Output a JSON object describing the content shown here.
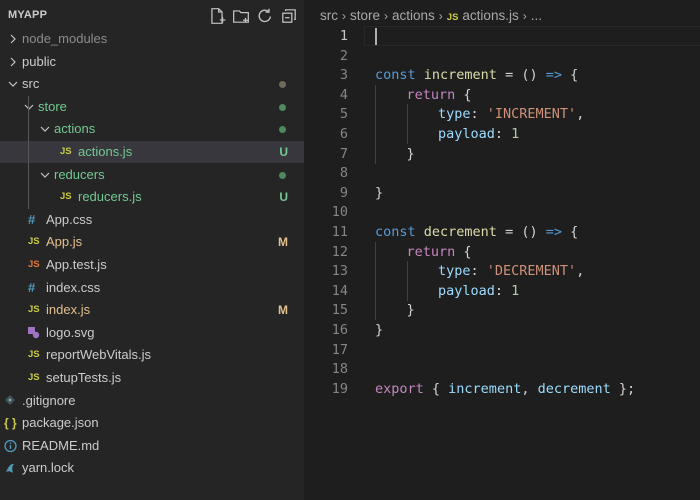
{
  "explorer": {
    "title": "MYAPP",
    "actions": [
      {
        "name": "new-file-icon"
      },
      {
        "name": "new-folder-icon"
      },
      {
        "name": "refresh-icon"
      },
      {
        "name": "collapse-all-icon"
      }
    ]
  },
  "tree": [
    {
      "label": "node_modules",
      "kind": "folder",
      "expanded": false,
      "depth": 0,
      "color": "grey"
    },
    {
      "label": "public",
      "kind": "folder",
      "expanded": false,
      "depth": 0,
      "color": "default"
    },
    {
      "label": "src",
      "kind": "folder",
      "expanded": true,
      "depth": 0,
      "color": "default",
      "decoration": "dot-grey"
    },
    {
      "label": "store",
      "kind": "folder",
      "expanded": true,
      "depth": 1,
      "color": "green",
      "decoration": "dot-green"
    },
    {
      "label": "actions",
      "kind": "folder",
      "expanded": true,
      "depth": 2,
      "color": "green",
      "decoration": "dot-green"
    },
    {
      "label": "actions.js",
      "kind": "js",
      "depth": 3,
      "color": "green",
      "badge": "U",
      "selected": true
    },
    {
      "label": "reducers",
      "kind": "folder",
      "expanded": true,
      "depth": 2,
      "color": "green",
      "decoration": "dot-green"
    },
    {
      "label": "reducers.js",
      "kind": "js",
      "depth": 3,
      "color": "green",
      "badge": "U"
    },
    {
      "label": "App.css",
      "kind": "css",
      "depth": 1,
      "color": "default"
    },
    {
      "label": "App.js",
      "kind": "js",
      "depth": 1,
      "color": "yellow",
      "badge": "M"
    },
    {
      "label": "App.test.js",
      "kind": "test",
      "depth": 1,
      "color": "default"
    },
    {
      "label": "index.css",
      "kind": "css",
      "depth": 1,
      "color": "default"
    },
    {
      "label": "index.js",
      "kind": "js",
      "depth": 1,
      "color": "yellow",
      "badge": "M"
    },
    {
      "label": "logo.svg",
      "kind": "svg",
      "depth": 1,
      "color": "default"
    },
    {
      "label": "reportWebVitals.js",
      "kind": "js",
      "depth": 1,
      "color": "default"
    },
    {
      "label": "setupTests.js",
      "kind": "js",
      "depth": 1,
      "color": "default"
    },
    {
      "label": ".gitignore",
      "kind": "git",
      "depth": 0,
      "color": "default"
    },
    {
      "label": "package.json",
      "kind": "json",
      "depth": 0,
      "color": "default"
    },
    {
      "label": "README.md",
      "kind": "info",
      "depth": 0,
      "color": "default"
    },
    {
      "label": "yarn.lock",
      "kind": "yarn",
      "depth": 0,
      "color": "default"
    }
  ],
  "breadcrumb": {
    "parts": [
      "src",
      "store",
      "actions"
    ],
    "file_icon": "JS",
    "file": "actions.js",
    "tail": "..."
  },
  "editor": {
    "active_line": 1,
    "lines": [
      {
        "n": "1",
        "tokens": []
      },
      {
        "n": "2",
        "tokens": []
      },
      {
        "n": "3",
        "tokens": [
          [
            "kw",
            "const"
          ],
          [
            "pun",
            " "
          ],
          [
            "fn",
            "increment"
          ],
          [
            "pun",
            " = () "
          ],
          [
            "arrow",
            "=>"
          ],
          [
            "pun",
            " {"
          ]
        ]
      },
      {
        "n": "4",
        "indent": 1,
        "tokens": [
          [
            "ctl",
            "return"
          ],
          [
            "pun",
            " {"
          ]
        ]
      },
      {
        "n": "5",
        "indent": 2,
        "tokens": [
          [
            "var",
            "type"
          ],
          [
            "pun",
            ": "
          ],
          [
            "str",
            "'INCREMENT'"
          ],
          [
            "pun",
            ","
          ]
        ]
      },
      {
        "n": "6",
        "indent": 2,
        "tokens": [
          [
            "var",
            "payload"
          ],
          [
            "pun",
            ": "
          ],
          [
            "num",
            "1"
          ]
        ]
      },
      {
        "n": "7",
        "indent": 1,
        "tokens": [
          [
            "pun",
            "}"
          ]
        ]
      },
      {
        "n": "8",
        "tokens": []
      },
      {
        "n": "9",
        "tokens": [
          [
            "pun",
            "}"
          ]
        ]
      },
      {
        "n": "10",
        "tokens": []
      },
      {
        "n": "11",
        "tokens": [
          [
            "kw",
            "const"
          ],
          [
            "pun",
            " "
          ],
          [
            "fn",
            "decrement"
          ],
          [
            "pun",
            " = () "
          ],
          [
            "arrow",
            "=>"
          ],
          [
            "pun",
            " {"
          ]
        ]
      },
      {
        "n": "12",
        "indent": 1,
        "tokens": [
          [
            "ctl",
            "return"
          ],
          [
            "pun",
            " {"
          ]
        ]
      },
      {
        "n": "13",
        "indent": 2,
        "tokens": [
          [
            "var",
            "type"
          ],
          [
            "pun",
            ": "
          ],
          [
            "str",
            "'DECREMENT'"
          ],
          [
            "pun",
            ","
          ]
        ]
      },
      {
        "n": "14",
        "indent": 2,
        "tokens": [
          [
            "var",
            "payload"
          ],
          [
            "pun",
            ": "
          ],
          [
            "num",
            "1"
          ]
        ]
      },
      {
        "n": "15",
        "indent": 1,
        "tokens": [
          [
            "pun",
            "}"
          ]
        ]
      },
      {
        "n": "16",
        "tokens": [
          [
            "pun",
            "}"
          ]
        ]
      },
      {
        "n": "17",
        "tokens": []
      },
      {
        "n": "18",
        "tokens": []
      },
      {
        "n": "19",
        "tokens": [
          [
            "ctl",
            "export"
          ],
          [
            "pun",
            " { "
          ],
          [
            "var",
            "increment"
          ],
          [
            "pun",
            ", "
          ],
          [
            "var",
            "decrement"
          ],
          [
            "pun",
            " };"
          ]
        ]
      }
    ]
  },
  "colors": {
    "background": "#1e1e1e",
    "sidebar": "#252526",
    "selected_row": "#37373d",
    "untracked": "#73c991",
    "modified": "#e2c08d"
  }
}
